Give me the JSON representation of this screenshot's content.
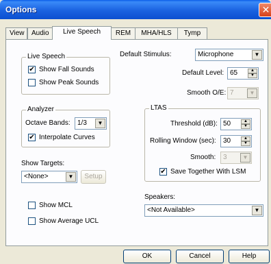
{
  "window": {
    "title": "Options",
    "close_glyph": "✕"
  },
  "tabs": [
    {
      "label": "View"
    },
    {
      "label": "Audio"
    },
    {
      "label": "Live Speech",
      "active": true
    },
    {
      "label": "REM"
    },
    {
      "label": "MHA/HLS"
    },
    {
      "label": "Tymp"
    }
  ],
  "live_speech": {
    "legend": "Live Speech",
    "show_fall_sounds": {
      "label": "Show Fall Sounds",
      "checked": true
    },
    "show_peak_sounds": {
      "label": "Show Peak Sounds",
      "checked": false
    }
  },
  "analyzer": {
    "legend": "Analyzer",
    "octave_bands_label": "Octave Bands:",
    "octave_bands_value": "1/3",
    "interpolate_curves": {
      "label": "Interpolate Curves",
      "checked": true
    }
  },
  "show_targets": {
    "label": "Show Targets:",
    "value": "<None>",
    "setup_label": "Setup"
  },
  "show_mcl": {
    "label": "Show MCL",
    "checked": false
  },
  "show_avg_ucl": {
    "label": "Show Average UCL",
    "checked": false
  },
  "stimulus": {
    "default_stimulus_label": "Default Stimulus:",
    "default_stimulus_value": "Microphone",
    "default_level_label": "Default Level:",
    "default_level_value": "65",
    "smooth_oe_label": "Smooth O/E:",
    "smooth_oe_value": "7"
  },
  "ltas": {
    "legend": "LTAS",
    "threshold_label": "Threshold (dB):",
    "threshold_value": "50",
    "rolling_window_label": "Rolling Window (sec):",
    "rolling_window_value": "30",
    "smooth_label": "Smooth:",
    "smooth_value": "3",
    "save_together": {
      "label": "Save Together With LSM",
      "checked": true
    }
  },
  "speakers": {
    "label": "Speakers:",
    "value": "<Not Available>"
  },
  "footer": {
    "ok_label": "OK",
    "cancel_label": "Cancel",
    "help_label": "Help"
  },
  "icons": {
    "check_glyph": "✔",
    "dropdown_glyph": "▼",
    "spin_up_glyph": "▲",
    "spin_down_glyph": "▼"
  },
  "colors": {
    "titlebar": "#0a5ee8",
    "close": "#d8401a",
    "dialog_bg": "#ece9d8",
    "panel_bg": "#fcfcfe"
  }
}
